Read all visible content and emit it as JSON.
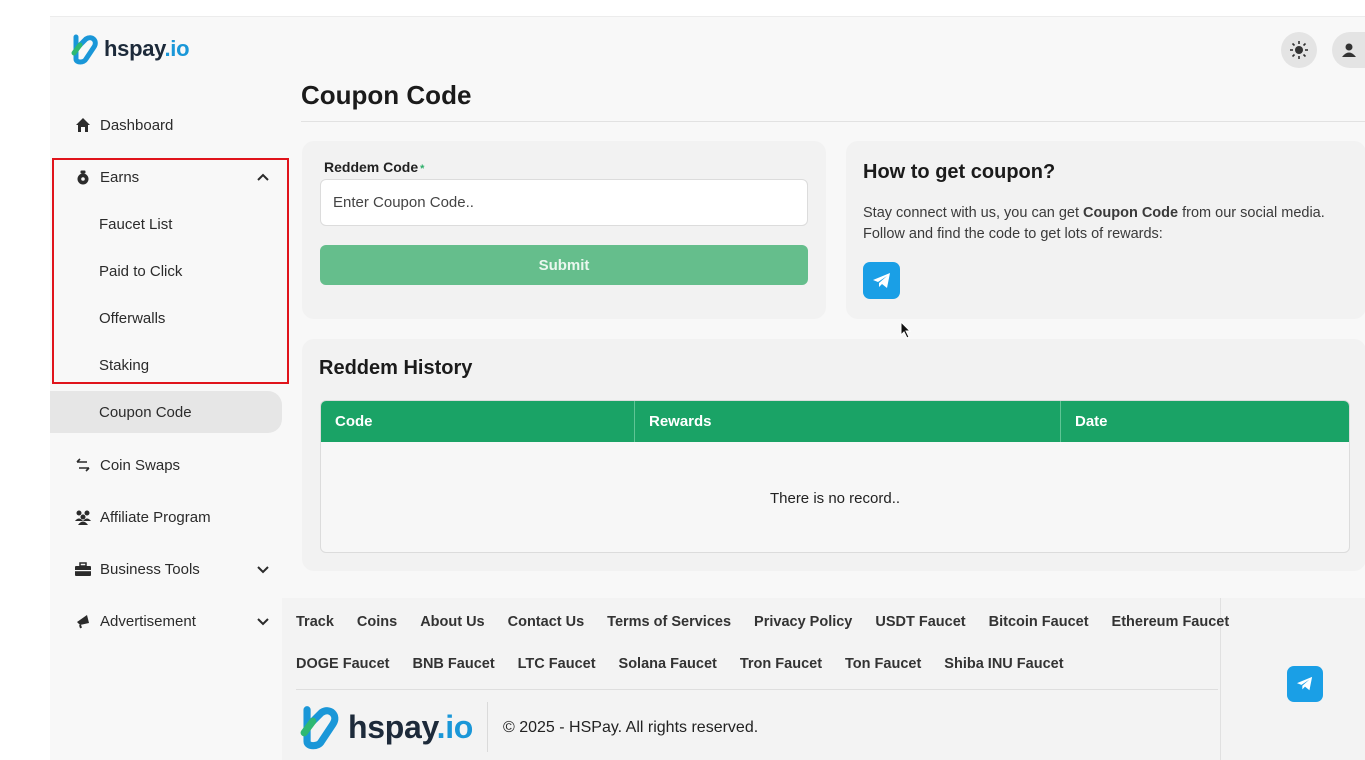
{
  "brand": {
    "name": "hspay",
    "tld": ".io"
  },
  "header": {
    "theme_icon": "sun-icon",
    "user_icon": "user-icon"
  },
  "sidebar": {
    "dashboard": "Dashboard",
    "earns": "Earns",
    "earns_sub": [
      "Faucet List",
      "Paid to Click",
      "Offerwalls",
      "Staking",
      "Coupon Code"
    ],
    "coin_swaps": "Coin Swaps",
    "affiliate": "Affiliate Program",
    "business_tools": "Business Tools",
    "advertisement": "Advertisement"
  },
  "page": {
    "title": "Coupon Code"
  },
  "redeem": {
    "label": "Reddem Code",
    "required_mark": "*",
    "placeholder": "Enter Coupon Code..",
    "submit_label": "Submit"
  },
  "how": {
    "title": "How to get coupon?",
    "text_before": "Stay connect with us, you can get ",
    "text_bold": "Coupon Code",
    "text_after": " from our social media. Follow and find the code to get lots of rewards:"
  },
  "history": {
    "title": "Reddem History",
    "columns": [
      "Code",
      "Rewards",
      "Date"
    ],
    "empty": "There is no record.."
  },
  "footer": {
    "links_row1": [
      "Track",
      "Coins",
      "About Us",
      "Contact Us",
      "Terms of Services",
      "Privacy Policy",
      "USDT Faucet",
      "Bitcoin Faucet",
      "Ethereum Faucet"
    ],
    "links_row2": [
      "DOGE Faucet",
      "BNB Faucet",
      "LTC Faucet",
      "Solana Faucet",
      "Tron Faucet",
      "Ton Faucet",
      "Shiba INU Faucet"
    ],
    "copyright": "© 2025 - HSPay. All rights reserved."
  },
  "colors": {
    "accent": "#1aa366",
    "submit": "#65be8c",
    "telegram": "#1a9fe6",
    "highlight": "#e0141b"
  }
}
